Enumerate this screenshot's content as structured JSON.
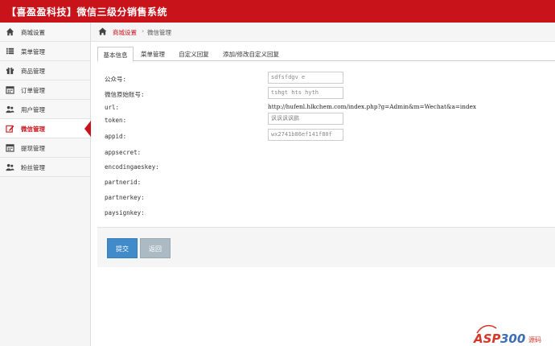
{
  "header": {
    "title": "【喜盈盈科技】微信三级分销售系统"
  },
  "sidebar": {
    "items": [
      {
        "label": "商城设置",
        "icon": "home-icon"
      },
      {
        "label": "菜单管理",
        "icon": "list-icon"
      },
      {
        "label": "商品管理",
        "icon": "gift-icon"
      },
      {
        "label": "订单管理",
        "icon": "calendar-icon"
      },
      {
        "label": "用户管理",
        "icon": "users-icon"
      },
      {
        "label": "微信管理",
        "icon": "edit-icon",
        "active": true
      },
      {
        "label": "提现管理",
        "icon": "calendar-icon"
      },
      {
        "label": "粉丝管理",
        "icon": "users-icon"
      }
    ]
  },
  "breadcrumb": {
    "home": "商城设置",
    "current": "微信管理"
  },
  "tabs": [
    {
      "label": "基本信息",
      "active": true
    },
    {
      "label": "菜单管理"
    },
    {
      "label": "自定义回复"
    },
    {
      "label": "添加/修改自定义回复"
    }
  ],
  "form": {
    "gzh_label": "公众号:",
    "gzh_value": "sdfsfdgv e",
    "wxid_label": "微信原始账号:",
    "wxid_value": "tshgt hts  hyth",
    "url_label": "url:",
    "url_value": "http://hufenl.hlkchem.com/index.php?g=Admin&m=Wechat&a=index",
    "token_label": "token:",
    "token_value": "讽讽讽讽鹏",
    "appid_label": "appid:",
    "appid_value": "wx2741b86ef141f80f",
    "appsecret_label": "appsecret:",
    "encodingaeskey_label": "encodingaeskey:",
    "partnerid_label": "partnerid:",
    "partnerkey_label": "partnerkey:",
    "paysignkey_label": "paysignkey:"
  },
  "buttons": {
    "submit": "提交",
    "back": "返回"
  },
  "watermark": {
    "text": "ASP300",
    "sub": "源码"
  },
  "colors": {
    "brand_red": "#c9131b",
    "primary_blue": "#428bca",
    "muted_gray": "#abbac3"
  }
}
